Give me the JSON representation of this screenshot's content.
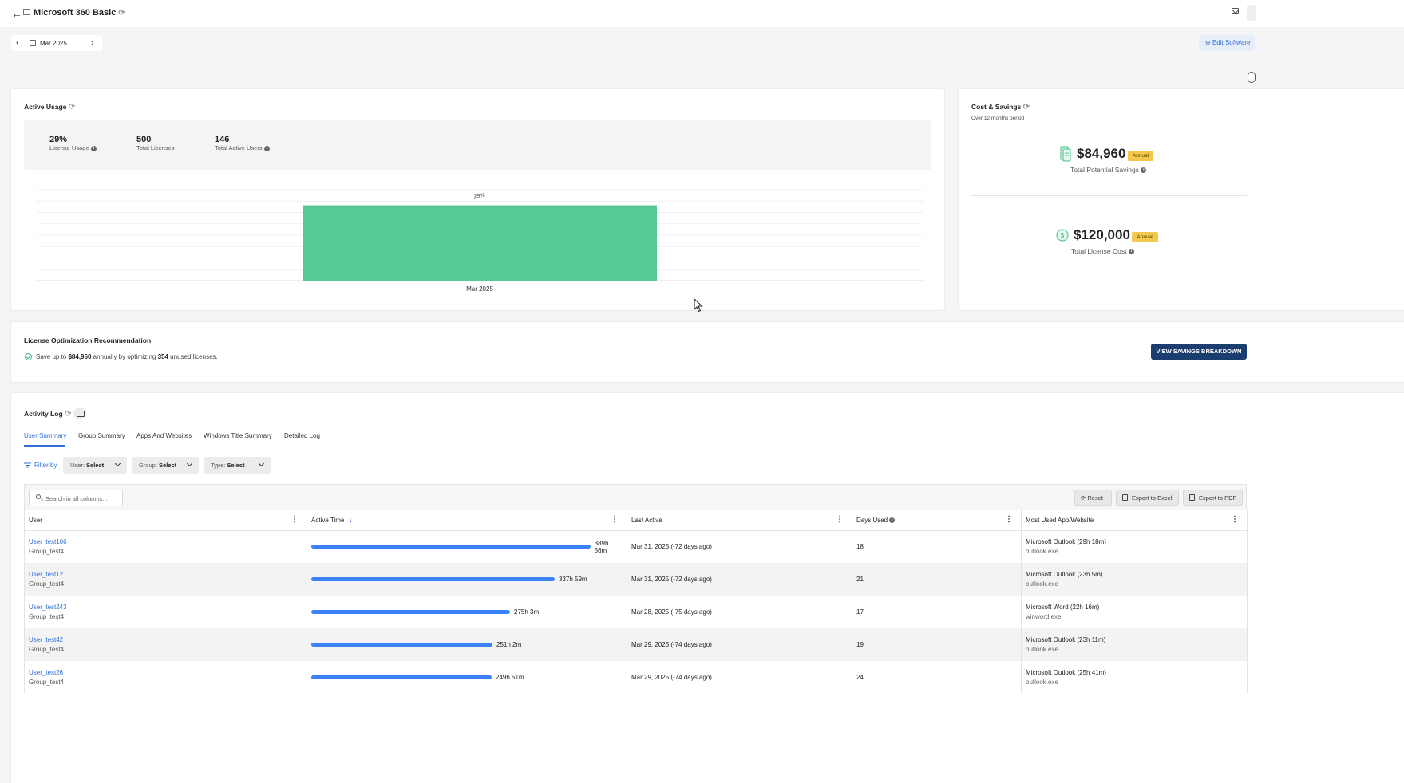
{
  "header": {
    "title": "Microsoft 360 Basic",
    "back_icon": "arrow-left-icon",
    "app_icon": "window-icon",
    "refresh_icon": "refresh-icon",
    "mail_icon": "mail-icon"
  },
  "toolbar": {
    "date": "Mar 2025",
    "edit_label": "Edit Software"
  },
  "active_usage": {
    "title": "Active Usage",
    "stats": [
      {
        "value": "29%",
        "label": "License Usage"
      },
      {
        "value": "500",
        "label": "Total Licenses"
      },
      {
        "value": "146",
        "label": "Total Active Users"
      }
    ]
  },
  "chart_data": {
    "type": "bar",
    "categories": [
      "Mar 2025"
    ],
    "values": [
      29
    ],
    "data_labels": [
      "29%"
    ],
    "ylim": [
      0,
      35
    ],
    "grid": true,
    "colors": {
      "bar": "#57c995"
    }
  },
  "cost_savings": {
    "title": "Cost & Savings",
    "subtitle": "Over 12 months period",
    "savings_value": "$84,960",
    "savings_badge": "Annual",
    "savings_label": "Total Potential Savings",
    "cost_value": "$120,000",
    "cost_badge": "Annual",
    "cost_label": "Total License Cost"
  },
  "optimization": {
    "title": "License Optimization Recommendation",
    "text_prefix": "Save up to ",
    "amount": "$84,960",
    "text_mid": " annually by optimizing ",
    "count": "354",
    "text_suffix": " unused licenses.",
    "button": "VIEW SAVINGS BREAKDOWN"
  },
  "activity_log": {
    "title": "Activity Log",
    "tabs": [
      "User Summary",
      "Group Summary",
      "Apps And Websites",
      "Windows Title Summary",
      "Detailed Log"
    ],
    "active_tab": "User Summary",
    "filter_label": "Filter by",
    "filters": [
      {
        "label": "User:",
        "value": "Select"
      },
      {
        "label": "Group:",
        "value": "Select"
      },
      {
        "label": "Type:",
        "value": "Select"
      }
    ],
    "search_placeholder": "Search in all columns...",
    "buttons": {
      "reset": "Reset",
      "excel": "Export to Excel",
      "pdf": "Export to PDF"
    },
    "columns": [
      "User",
      "Active Time",
      "Last Active",
      "Days Used",
      "Most Used App/Website"
    ],
    "rows": [
      {
        "user": "User_test106",
        "group": "Group_test4",
        "active_time": "389h 56m",
        "active_fraction": 1.0,
        "last_active": "Mar 31, 2025 (-72 days ago)",
        "days_used": "18",
        "app": "Microsoft Outlook (29h 18m)",
        "exe": "outlook.exe"
      },
      {
        "user": "User_test12",
        "group": "Group_test4",
        "active_time": "337h 59m",
        "active_fraction": 0.867,
        "last_active": "Mar 31, 2025 (-72 days ago)",
        "days_used": "21",
        "app": "Microsoft Outlook (23h 5m)",
        "exe": "outlook.exe"
      },
      {
        "user": "User_test243",
        "group": "Group_test4",
        "active_time": "275h 3m",
        "active_fraction": 0.706,
        "last_active": "Mar 28, 2025 (-75 days ago)",
        "days_used": "17",
        "app": "Microsoft Word (22h 16m)",
        "exe": "winword.exe"
      },
      {
        "user": "User_test42",
        "group": "Group_test4",
        "active_time": "251h 2m",
        "active_fraction": 0.644,
        "last_active": "Mar 29, 2025 (-74 days ago)",
        "days_used": "19",
        "app": "Microsoft Outlook (23h 11m)",
        "exe": "outlook.exe"
      },
      {
        "user": "User_test26",
        "group": "Group_test4",
        "active_time": "249h 51m",
        "active_fraction": 0.641,
        "last_active": "Mar 29, 2025 (-74 days ago)",
        "days_used": "24",
        "app": "Microsoft Outlook (25h 41m)",
        "exe": "outlook.exe"
      }
    ]
  },
  "colors": {
    "accent": "#2f6fd6",
    "primary_button": "#1c3e6e",
    "badge": "#f2c94c",
    "bar": "#3b82f6",
    "chart_bar": "#57c995"
  }
}
